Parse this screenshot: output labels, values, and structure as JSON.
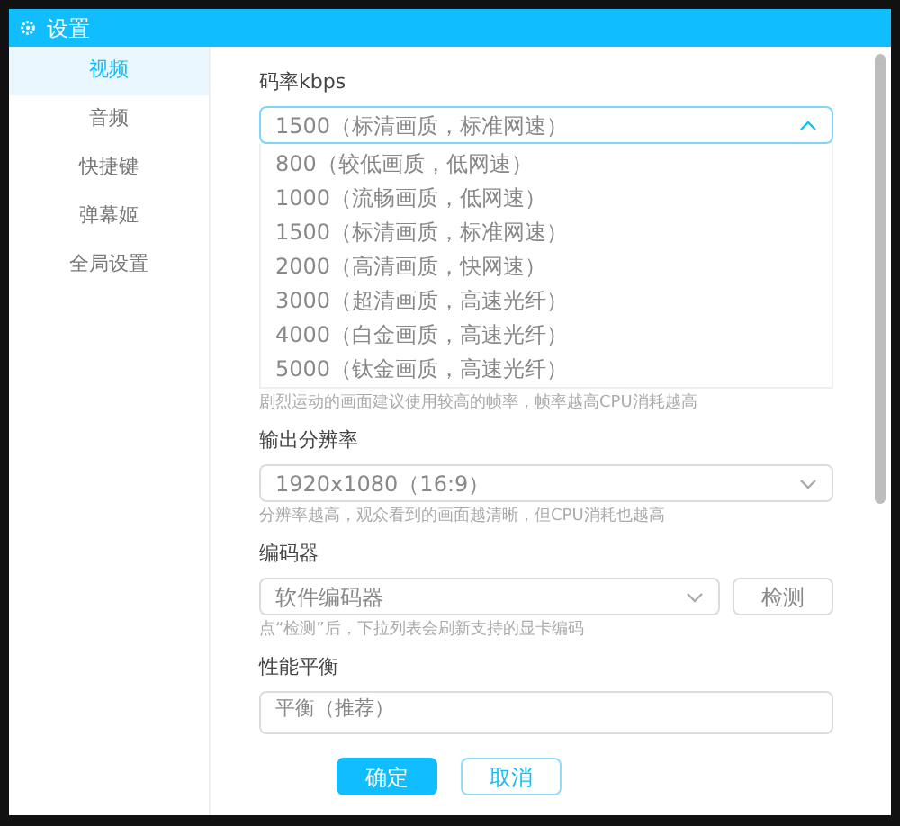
{
  "window": {
    "title": "设置"
  },
  "sidebar": {
    "items": [
      {
        "label": "视频",
        "selected": true
      },
      {
        "label": "音频",
        "selected": false
      },
      {
        "label": "快捷键",
        "selected": false
      },
      {
        "label": "弹幕姬",
        "selected": false
      },
      {
        "label": "全局设置",
        "selected": false
      }
    ]
  },
  "bitrate": {
    "label": "码率kbps",
    "value": "1500（标清画质，标准网速）",
    "expanded": true,
    "options": [
      {
        "label": "800（较低画质，低网速）"
      },
      {
        "label": "1000（流畅画质，低网速）"
      },
      {
        "label": "1500（标清画质，标准网速）"
      },
      {
        "label": "2000（高清画质，快网速）"
      },
      {
        "label": "3000（超清画质，高速光纤）"
      },
      {
        "label": "4000（白金画质，高速光纤）"
      },
      {
        "label": "5000（钛金画质，高速光纤）"
      }
    ],
    "hint": "剧烈运动的画面建议使用较高的帧率，帧率越高CPU消耗越高"
  },
  "resolution": {
    "label": "输出分辨率",
    "value": "1920x1080（16:9）",
    "expanded": false,
    "hint": "分辨率越高，观众看到的画面越清晰，但CPU消耗也越高"
  },
  "encoder": {
    "label": "编码器",
    "value": "软件编码器",
    "expanded": false,
    "button": "检测",
    "hint": "点“检测”后，下拉列表会刷新支持的显卡编码"
  },
  "balance": {
    "label": "性能平衡",
    "value": "平衡（推荐）"
  },
  "buttons": [
    {
      "label": "确定",
      "kind": "primary"
    },
    {
      "label": "取消",
      "kind": "secondary"
    }
  ]
}
